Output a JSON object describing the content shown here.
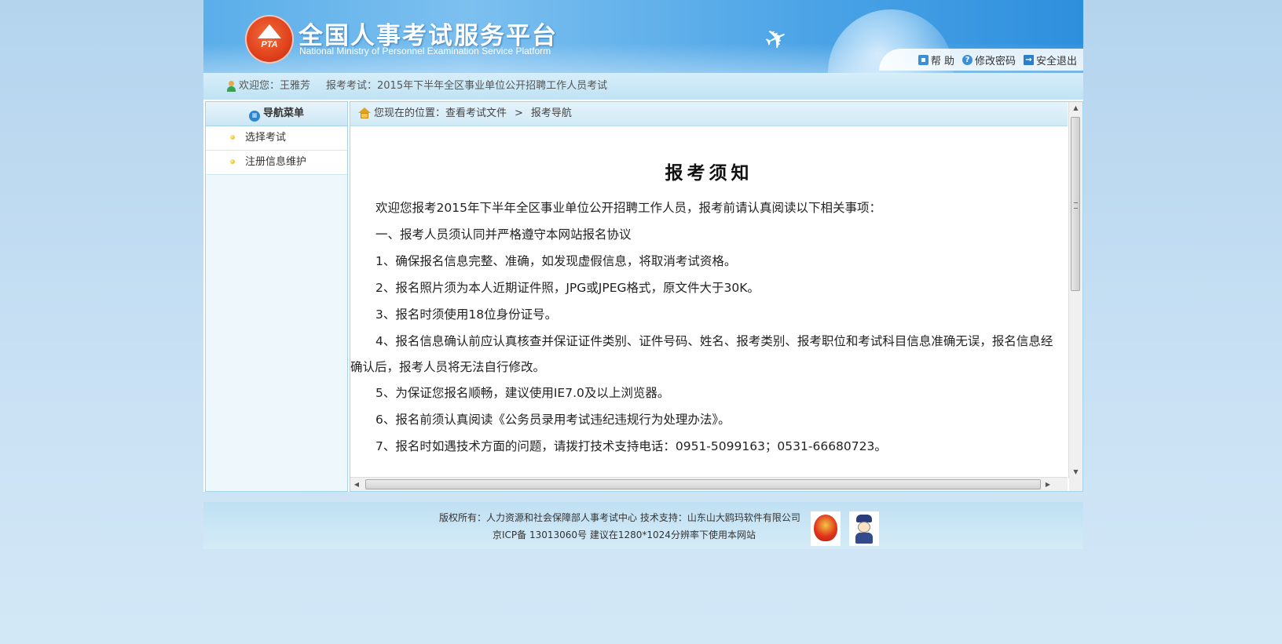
{
  "header": {
    "logo_text": "PTA",
    "title": "全国人事考试服务平台",
    "subtitle": "National Ministry of Personnel Examination Service Platform",
    "tools": [
      {
        "label": "帮 助",
        "icon": "lock-icon"
      },
      {
        "label": "修改密码",
        "icon": "question-icon"
      },
      {
        "label": "安全退出",
        "icon": "exit-icon"
      }
    ]
  },
  "welcome": {
    "greeting": "欢迎您：王雅芳",
    "exam": "报考考试：2015年下半年全区事业单位公开招聘工作人员考试"
  },
  "sidebar": {
    "title": "导航菜单",
    "items": [
      {
        "label": "选择考试"
      },
      {
        "label": "注册信息维护"
      }
    ]
  },
  "breadcrumb": {
    "prefix": "您现在的位置：查看考试文件",
    "separator": ">",
    "current": "报考导航"
  },
  "document": {
    "title": "报考须知",
    "paragraphs": [
      "欢迎您报考2015年下半年全区事业单位公开招聘工作人员，报考前请认真阅读以下相关事项：",
      "一、报考人员须认同并严格遵守本网站报名协议",
      "1、确保报名信息完整、准确，如发现虚假信息，将取消考试资格。",
      "2、报名照片须为本人近期证件照，JPG或JPEG格式，原文件大于30K。",
      "3、报名时须使用18位身份证号。",
      "4、报名信息确认前应认真核查并保证证件类别、证件号码、姓名、报考类别、报考职位和考试科目信息准确无误，报名信息经确认后，报考人员将无法自行修改。",
      "5、为保证您报名顺畅，建议使用IE7.0及以上浏览器。",
      "6、报名前须认真阅读《公务员录用考试违纪违规行为处理办法》。",
      "7、报名时如遇技术方面的问题，请拨打技术支持电话：0951-5099163；0531-66680723。"
    ]
  },
  "footer": {
    "line1": "版权所有：人力资源和社会保障部人事考试中心   技术支持：山东山大鸥玛软件有限公司",
    "line2": "京ICP备 13013060号   建议在1280*1024分辨率下使用本网站"
  }
}
